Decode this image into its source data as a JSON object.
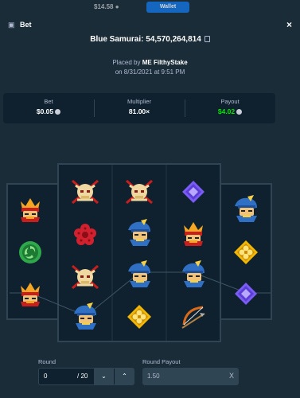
{
  "topbar": {
    "balance": "$14.58 ●",
    "wallet_label": "Wallet"
  },
  "modal": {
    "title": "Bet",
    "close": "×"
  },
  "game": {
    "title": "Blue Samurai: 54,570,264,814"
  },
  "placed": {
    "prefix": "Placed by",
    "user": "ME FilthyStake",
    "date": "on 8/31/2021 at 9:51 PM"
  },
  "stats": {
    "bet": {
      "label": "Bet",
      "value": "$0.05"
    },
    "multiplier": {
      "label": "Multiplier",
      "value": "81.00×"
    },
    "payout": {
      "label": "Payout",
      "value": "$4.02"
    }
  },
  "colors": {
    "accent_green": "#00e701",
    "panel": "#1a2c38",
    "dark": "#0f212e",
    "border": "#2f4553"
  },
  "reels": [
    [
      "red-samurai-icon",
      "green-spiral-icon",
      "red-samurai-icon"
    ],
    [
      "golden-skull-icon",
      "red-flower-icon",
      "golden-skull-icon",
      "blue-samurai-icon"
    ],
    [
      "golden-skull-icon",
      "blue-samurai-icon",
      "blue-samurai-icon",
      "gold-coin-icon"
    ],
    [
      "purple-gem-icon",
      "red-samurai-icon",
      "blue-samurai-icon",
      "bow-icon"
    ],
    [
      "blue-samurai-icon",
      "gold-coin-icon",
      "purple-gem-icon"
    ]
  ],
  "round": {
    "label": "Round",
    "value": "0",
    "total": "/ 20",
    "down": "⌄",
    "up": "⌃"
  },
  "round_payout": {
    "label": "Round Payout",
    "value": "1.50",
    "clear": "X"
  }
}
